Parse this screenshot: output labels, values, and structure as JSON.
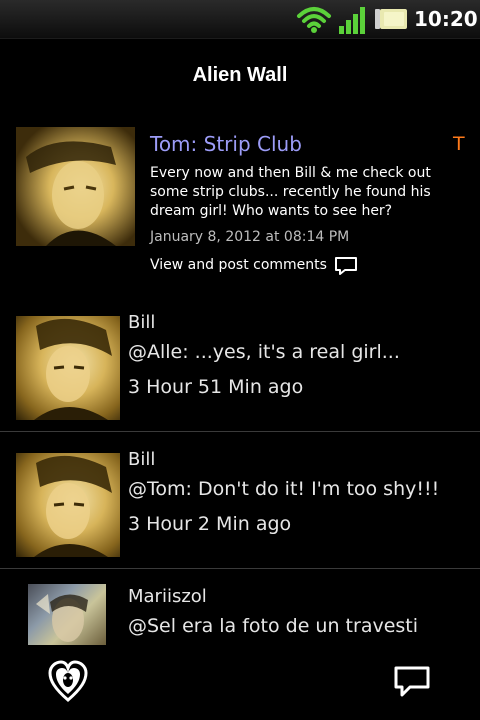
{
  "status_bar": {
    "time": "10:20",
    "icons": [
      "wifi-icon",
      "signal-icon",
      "battery-icon"
    ]
  },
  "header": {
    "title": "Alien Wall"
  },
  "featured_post": {
    "title": "Tom: Strip Club",
    "marker": "T",
    "body": "Every now and then Bill & me check out some strip clubs... recently he found his dream girl! Who wants to see her?",
    "date": "January 8, 2012 at 08:14 PM",
    "comments_link": "View and post comments"
  },
  "comments": [
    {
      "name": "Bill",
      "message": "@Alle: ...yes, it's a real girl...",
      "ago": "3 Hour 51 Min ago"
    },
    {
      "name": "Bill",
      "message": "@Tom: Don't do it! I'm too shy!!!",
      "ago": "3 Hour 2 Min ago"
    },
    {
      "name": "Mariiszol",
      "message": "@Sel era la foto de un travesti",
      "ago": ""
    }
  ],
  "bottom_bar": {
    "icons": [
      "heart-logo-icon",
      "chat-icon"
    ]
  },
  "colors": {
    "background": "#000000",
    "title_accent": "#9c9cf7",
    "marker_accent": "#ff7a1a",
    "status_green": "#5bd13a"
  }
}
